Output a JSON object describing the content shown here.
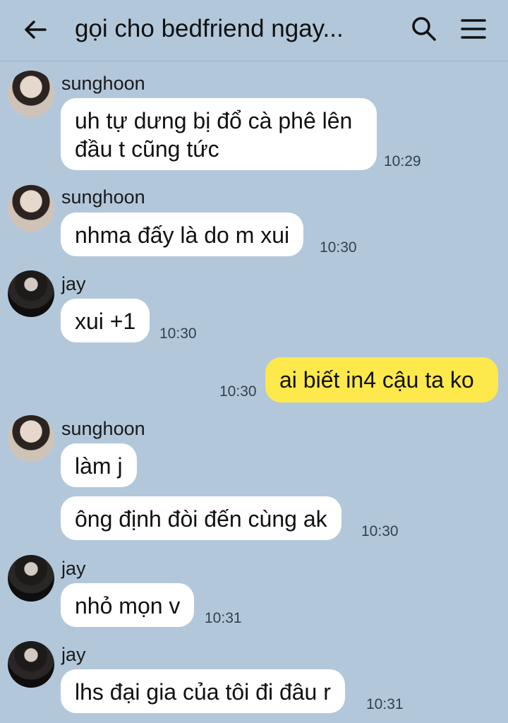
{
  "header": {
    "title": "gọi cho bedfriend ngay...",
    "icons": [
      "back-arrow-icon",
      "search-icon",
      "menu-icon"
    ]
  },
  "messages": [
    {
      "sender": "sunghoon",
      "text_line1": "uh tự dưng bị đổ cà phê lên",
      "text_line2": "đầu t cũng tức",
      "time": "10:29"
    },
    {
      "sender": "sunghoon",
      "text": "nhma đấy là do m xui",
      "time": "10:30"
    },
    {
      "sender": "jay",
      "text": "xui +1",
      "time": "10:30"
    },
    {
      "sender": "me",
      "text": "ai biết in4 cậu ta ko",
      "time": "10:30"
    },
    {
      "sender": "sunghoon",
      "text": "làm j",
      "time": ""
    },
    {
      "sender": "sunghoon",
      "text": "ông định đòi đến cùng ak",
      "time": "10:30"
    },
    {
      "sender": "jay",
      "text": "nhỏ mọn v",
      "time": "10:31"
    },
    {
      "sender": "jay",
      "text": "lhs đại gia của tôi đi đâu r",
      "time": "10:31"
    }
  ],
  "colors": {
    "background": "#b2c7da",
    "incoming_bubble": "#ffffff",
    "outgoing_bubble": "#fde94c"
  }
}
